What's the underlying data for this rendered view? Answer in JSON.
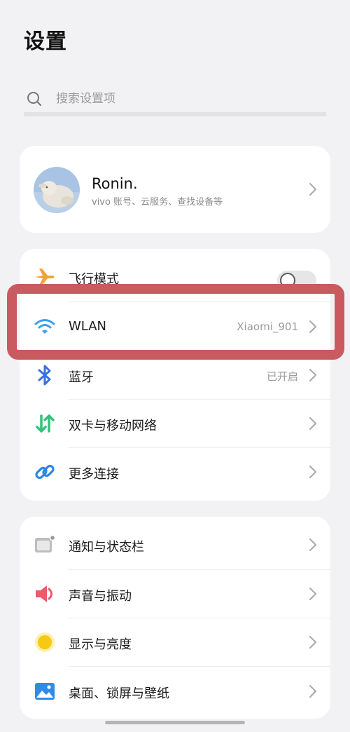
{
  "header": {
    "title": "设置"
  },
  "search": {
    "placeholder": "搜索设置项",
    "value": ""
  },
  "profile": {
    "name": "Ronin.",
    "subtitle": "vivo 账号、云服务、查找设备等"
  },
  "connectivity": [
    {
      "label": "飞行模式",
      "icon": "airplane-icon",
      "control": "toggle",
      "toggle_on": false
    },
    {
      "label": "WLAN",
      "value": "Xiaomi_901",
      "icon": "wifi-icon"
    },
    {
      "label": "蓝牙",
      "value": "已开启",
      "icon": "bluetooth-icon"
    },
    {
      "label": "双卡与移动网络",
      "icon": "dual-sim-icon"
    },
    {
      "label": "更多连接",
      "icon": "link-icon"
    }
  ],
  "general": [
    {
      "label": "通知与状态栏",
      "icon": "notification-icon"
    },
    {
      "label": "声音与振动",
      "icon": "sound-icon"
    },
    {
      "label": "显示与亮度",
      "icon": "brightness-icon"
    },
    {
      "label": "桌面、锁屏与壁纸",
      "icon": "wallpaper-icon"
    }
  ],
  "colors": {
    "background": "#f2f2f4",
    "card": "#ffffff",
    "highlight_frame": "#c95b60",
    "airplane": "#f0a43a",
    "wifi": "#3aa0e8",
    "bluetooth": "#3b6fe0",
    "dual_sim": "#2fc27a",
    "link": "#2f86e0",
    "sound": "#ec5a6b",
    "brightness": "#f7c815",
    "wallpaper": "#2f8be6"
  }
}
